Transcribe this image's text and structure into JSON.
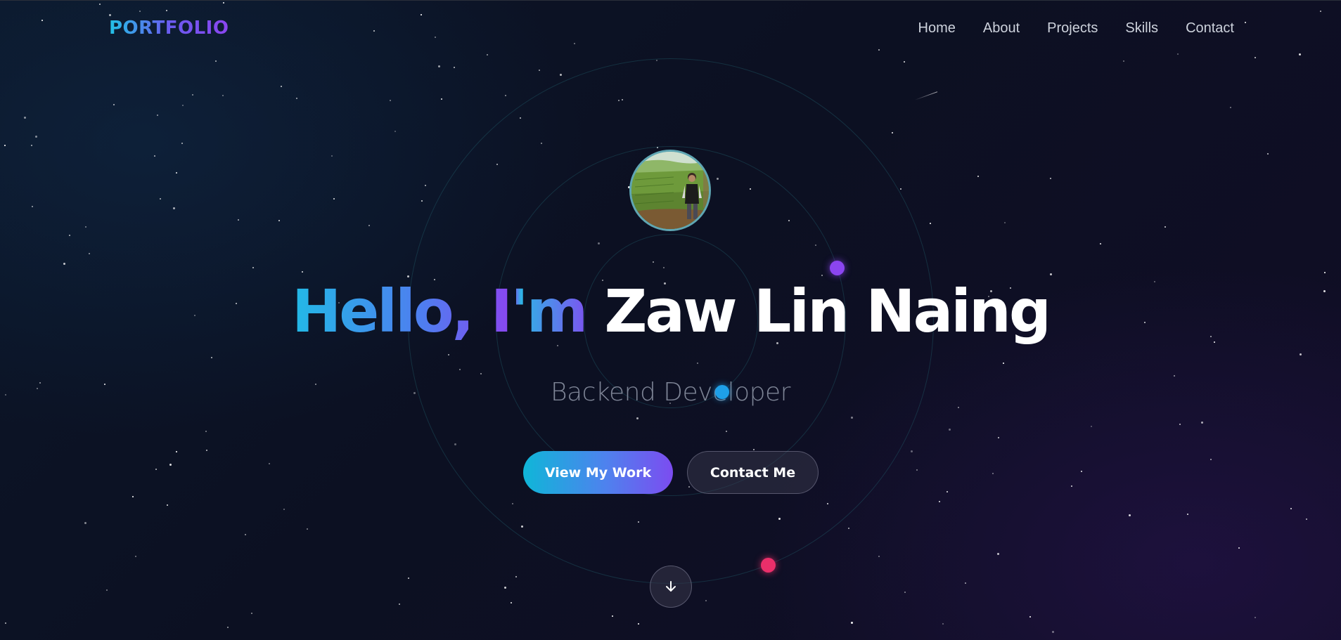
{
  "header": {
    "logo": "PORTFOLIO",
    "nav": [
      "Home",
      "About",
      "Projects",
      "Skills",
      "Contact"
    ]
  },
  "hero": {
    "greeting": "Hello, I'm",
    "name": "Zaw Lin Naing",
    "role": "Backend Developer",
    "primary_button": "View My Work",
    "secondary_button": "Contact Me",
    "scroll_icon": "arrow-down-icon",
    "avatar": "profile-photo"
  },
  "colors": {
    "accent_cyan": "#22c1e6",
    "accent_purple": "#8b45f0",
    "accent_pink": "#ea2f6a",
    "background": "#0b1020"
  }
}
